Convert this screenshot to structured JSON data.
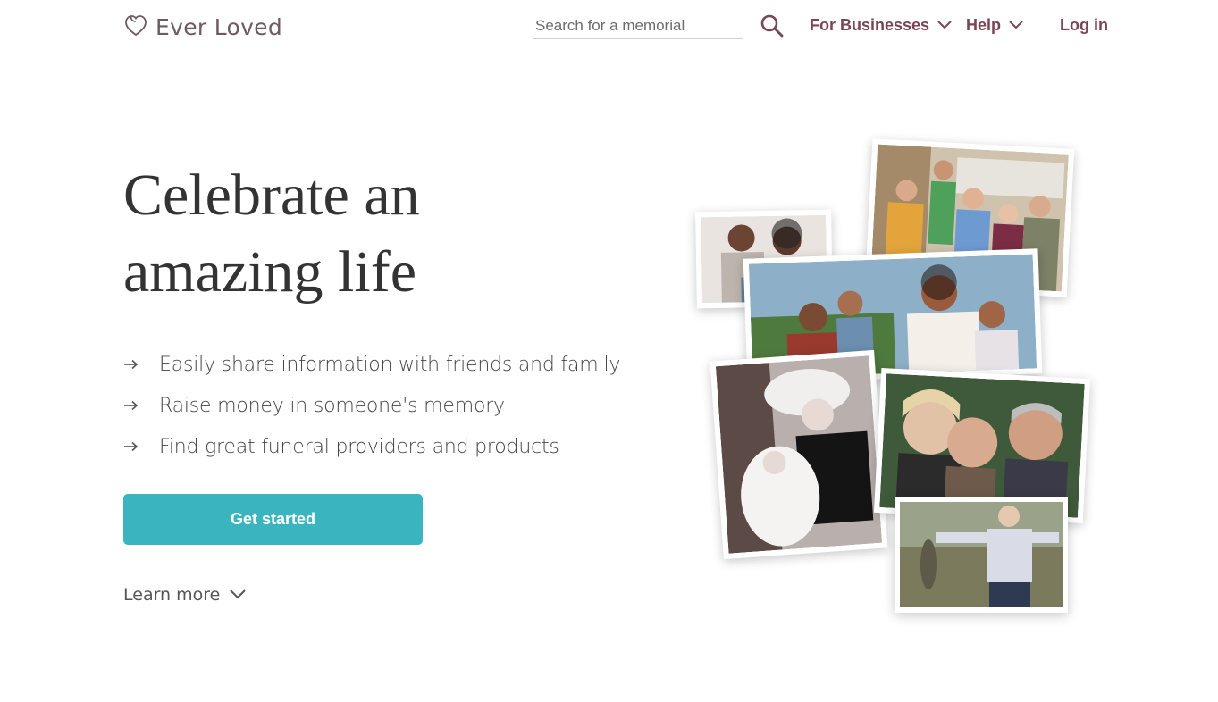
{
  "header": {
    "logo_text": "Ever Loved",
    "search_placeholder": "Search for a memorial",
    "nav": {
      "businesses": "For Businesses",
      "help": "Help",
      "login": "Log in"
    }
  },
  "hero": {
    "headline_line1": "Celebrate an",
    "headline_line2": "amazing life",
    "features": [
      "Easily share information with friends and family",
      "Raise money in someone's memory",
      "Find great funeral providers and products"
    ],
    "cta_label": "Get started",
    "learn_more": "Learn more"
  },
  "colors": {
    "accent": "#3ab4bf",
    "brand": "#7a4656",
    "logo": "#6e5a5f"
  },
  "icons": [
    "logo-heart-icon",
    "search-icon",
    "chevron-down-icon",
    "arrow-right-icon"
  ]
}
